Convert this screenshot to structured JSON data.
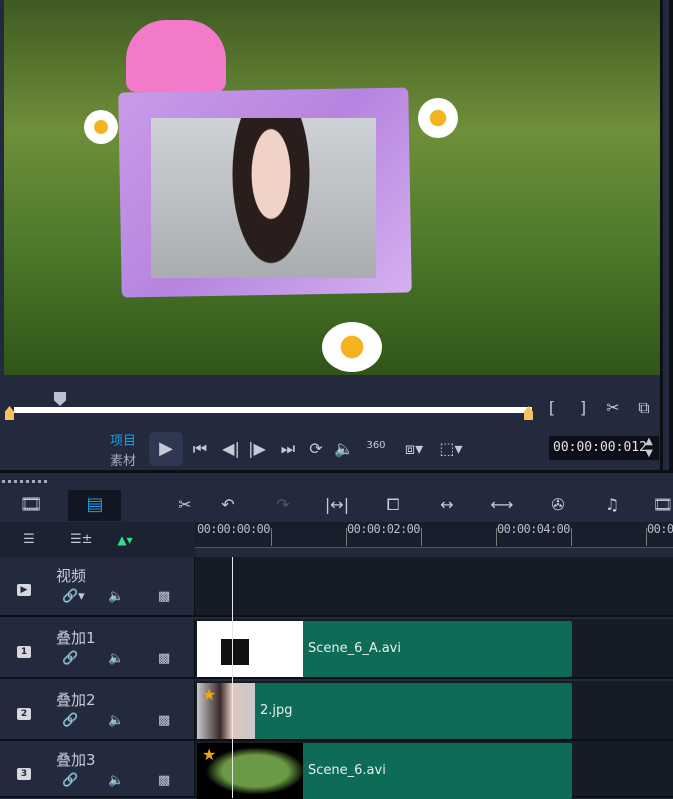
{
  "player": {
    "mode_project": "项目",
    "mode_clip": "素材",
    "timecode": "00:00:00:012",
    "icons": [
      "play-icon",
      "skip-start-icon",
      "prev-frame-icon",
      "next-frame-icon",
      "skip-end-icon",
      "repeat-icon",
      "volume-icon",
      "360-icon",
      "aspect-icon",
      "crop-select-icon",
      "mark-in-icon",
      "mark-out-icon",
      "scissors-icon",
      "copy-icon"
    ],
    "label_360": "360"
  },
  "timeline": {
    "ruler": [
      "00:00:00:00",
      "00:00:02:00",
      "00:00:04:00",
      "00:0"
    ],
    "tracks": [
      {
        "num": "▶",
        "name": "视频"
      },
      {
        "num": "1",
        "name": "叠加1",
        "clip": "Scene_6_A.avi"
      },
      {
        "num": "2",
        "name": "叠加2",
        "clip": "2.jpg"
      },
      {
        "num": "3",
        "name": "叠加3",
        "clip": "Scene_6.avi"
      }
    ],
    "colors": {
      "clip": "#0e6b58",
      "accent": "#1e9be0",
      "mark_in": "#f4c060"
    }
  }
}
